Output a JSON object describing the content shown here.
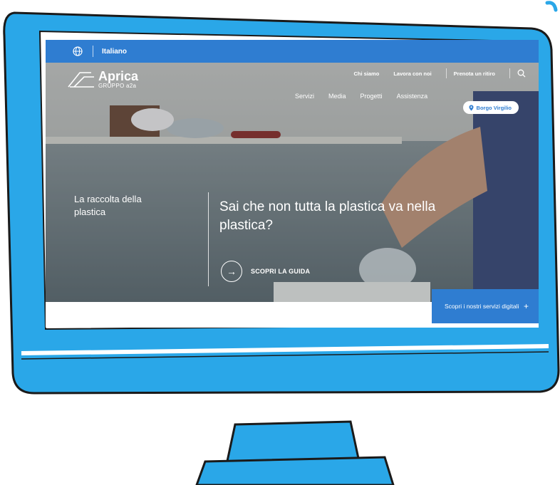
{
  "colors": {
    "frame": "#2aa7e8",
    "brand_blue": "#2f7dd1",
    "outline": "#1a1a1a"
  },
  "topbar": {
    "language": "Italiano",
    "icon": "globe-icon"
  },
  "logo": {
    "name": "Aprica",
    "subtitle": "GRUPPO a2a"
  },
  "utility_nav": {
    "items": [
      "Chi siamo",
      "Lavora con noi",
      "Prenota un ritiro"
    ],
    "search_icon": "search-icon"
  },
  "main_nav": {
    "items": [
      "Servizi",
      "Media",
      "Progetti",
      "Assistenza"
    ]
  },
  "location": {
    "label": "Borgo Virgilio",
    "icon": "pin-icon"
  },
  "hero": {
    "category": "La raccolta della plastica",
    "headline": "Sai che non tutta la plastica va nella plastica?",
    "cta_label": "SCOPRI LA GUIDA",
    "cta_icon": "arrow-right-icon"
  },
  "digital_services": {
    "label": "Scopri i nostri servizi digitali",
    "icon": "plus-icon"
  }
}
